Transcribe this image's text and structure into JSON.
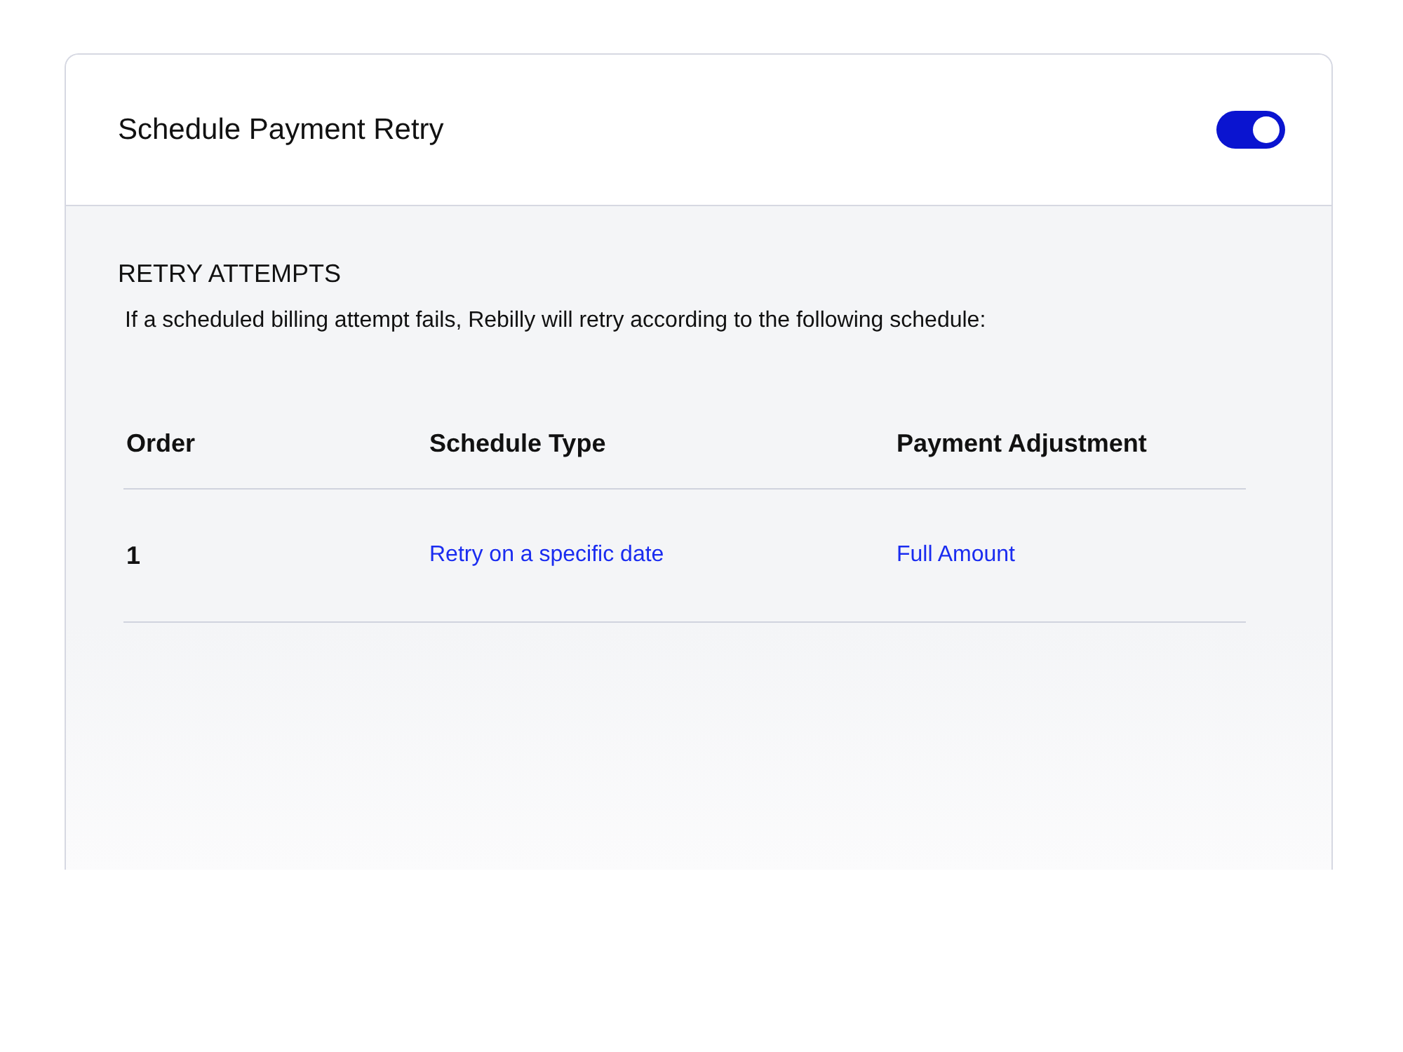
{
  "header": {
    "title": "Schedule Payment Retry",
    "toggle": {
      "on": true
    }
  },
  "section": {
    "heading": "RETRY ATTEMPTS",
    "description": "If a scheduled billing attempt fails, Rebilly will retry according to the following schedule:"
  },
  "table": {
    "columns": [
      "Order",
      "Schedule Type",
      "Payment Adjustment"
    ],
    "rows": [
      {
        "order": "1",
        "schedule_type": "Retry on a specific date",
        "payment_adjustment": "Full Amount"
      }
    ]
  }
}
